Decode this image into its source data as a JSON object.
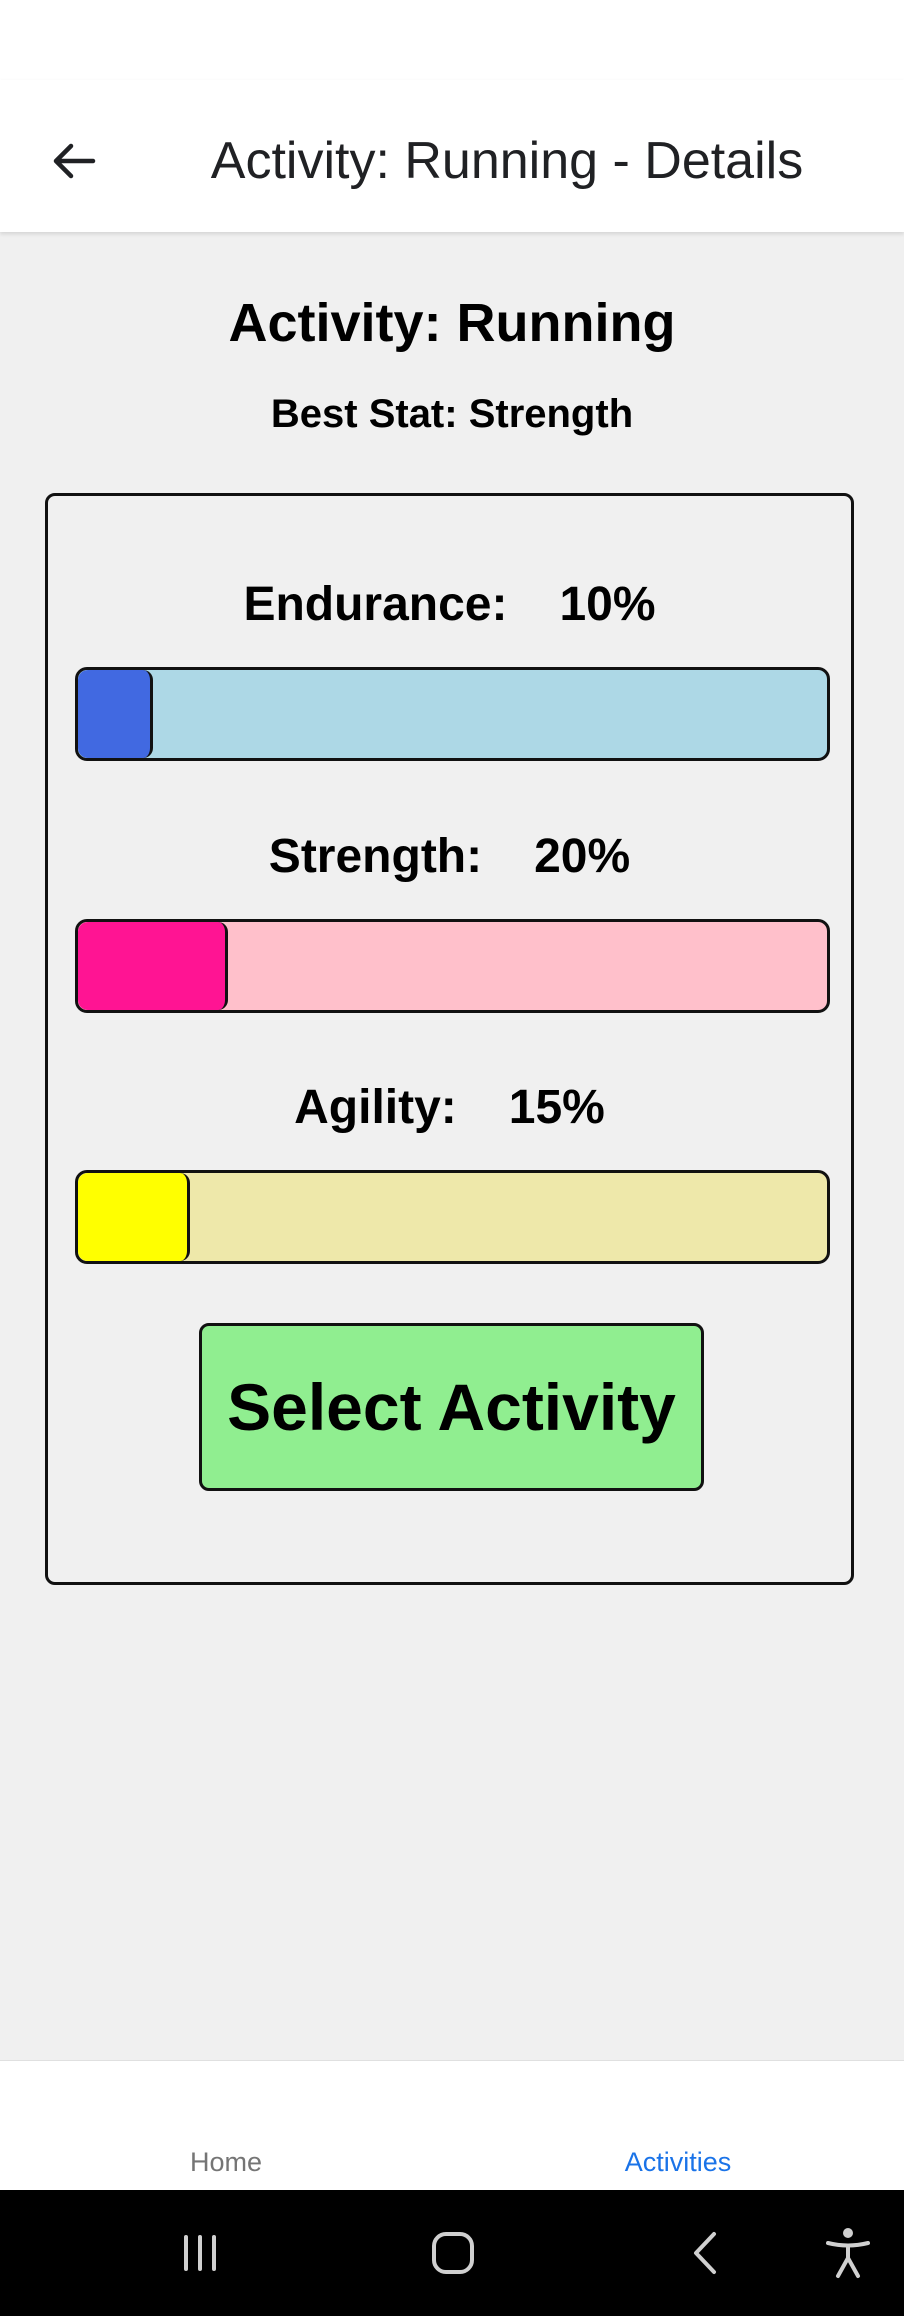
{
  "header": {
    "back_icon": "arrow-left-icon",
    "title": "Activity: Running - Details"
  },
  "activity": {
    "title": "Activity: Running",
    "best_stat": "Best Stat: Strength"
  },
  "stats": [
    {
      "name": "Endurance:",
      "value_label": "10%",
      "value": 0.1,
      "fill_color": "#4169e1",
      "track_color": "#add8e6"
    },
    {
      "name": "Strength:",
      "value_label": "20%",
      "value": 0.2,
      "fill_color": "#ff1493",
      "track_color": "#ffc0cb"
    },
    {
      "name": "Agility:",
      "value_label": "15%",
      "value": 0.15,
      "fill_color": "#ffff00",
      "track_color": "#eee8aa"
    }
  ],
  "actions": {
    "select_label": "Select Activity",
    "select_color": "#90ee90"
  },
  "bottom_nav": {
    "tabs": [
      {
        "label": "Home",
        "active": false
      },
      {
        "label": "Activities",
        "active": true
      }
    ],
    "active_color": "#1a73e8",
    "inactive_color": "#757575"
  },
  "system_nav": {
    "icons": [
      "recent-apps-icon",
      "home-icon",
      "back-icon",
      "accessibility-icon"
    ]
  }
}
